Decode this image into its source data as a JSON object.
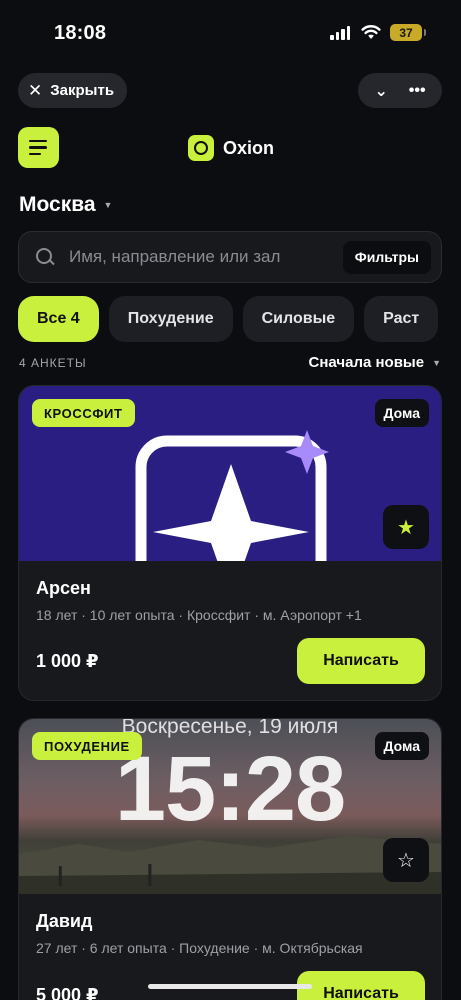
{
  "status_bar": {
    "time": "18:08",
    "battery": "37"
  },
  "sheet": {
    "close_label": "Закрыть"
  },
  "app": {
    "brand": "Oxion",
    "city": "Москва"
  },
  "search": {
    "placeholder": "Имя, направление или зал",
    "filters_label": "Фильтры"
  },
  "chips": [
    {
      "label": "Все 4",
      "active": true
    },
    {
      "label": "Похудение"
    },
    {
      "label": "Силовые"
    },
    {
      "label": "Раст"
    }
  ],
  "list": {
    "count": "4 АНКЕТЫ",
    "sort": "Сначала новые"
  },
  "cards": [
    {
      "tag": "КРОССФИТ",
      "location": "Дома",
      "favorite": true,
      "name": "Арсен",
      "meta": "18 лет · 10 лет опыта · Кроссфит · м. Аэропорт +1",
      "price": "1 000 ₽",
      "action": "Написать"
    },
    {
      "tag": "ПОХУДЕНИЕ",
      "location": "Дома",
      "favorite": false,
      "photo_date": "Воскресенье, 19 июля",
      "photo_time": "15:28",
      "name": "Давид",
      "meta": "27 лет · 6 лет опыта · Похудение · м. Октябрьская",
      "price": "5 000 ₽",
      "action": "Написать"
    }
  ],
  "colors": {
    "accent": "#c8f03c",
    "background": "#0c0d10",
    "card": "#17191d"
  }
}
